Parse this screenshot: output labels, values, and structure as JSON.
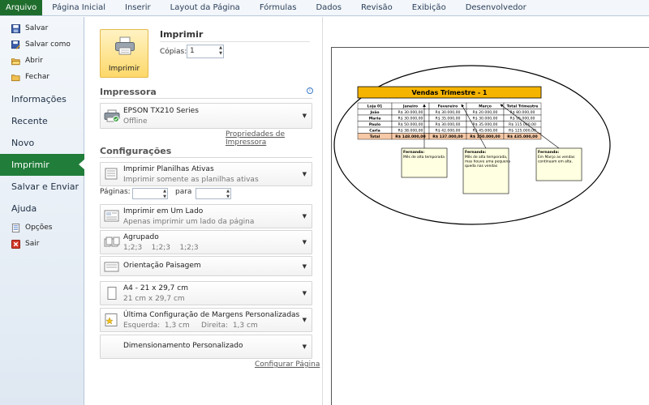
{
  "ribbon": {
    "tabs": [
      "Arquivo",
      "Página Inicial",
      "Inserir",
      "Layout da Página",
      "Fórmulas",
      "Dados",
      "Revisão",
      "Exibição",
      "Desenvolvedor"
    ]
  },
  "nav": {
    "save": "Salvar",
    "save_as": "Salvar como",
    "open": "Abrir",
    "close": "Fechar",
    "info": "Informações",
    "recent": "Recente",
    "new": "Novo",
    "print": "Imprimir",
    "save_send": "Salvar e Enviar",
    "help": "Ajuda",
    "options": "Opções",
    "exit": "Sair"
  },
  "print": {
    "button_label": "Imprimir",
    "title": "Imprimir",
    "copies_label": "Cópias:",
    "copies_value": "1"
  },
  "printer": {
    "section_title": "Impressora",
    "name": "EPSON TX210 Series",
    "status": "Offline",
    "properties_link": "Propriedades de Impressora"
  },
  "settings": {
    "section_title": "Configurações",
    "scope_main": "Imprimir Planilhas Ativas",
    "scope_sub": "Imprimir somente as planilhas ativas",
    "pages_label": "Páginas:",
    "to_label": "para",
    "sides_main": "Imprimir em Um Lado",
    "sides_sub": "Apenas imprimir um lado da página",
    "collate_main": "Agrupado",
    "collate_sub": "1;2;3    1;2;3    1;2;3",
    "orientation": "Orientação Paisagem",
    "paper_main": "A4 - 21 x 29,7 cm",
    "paper_sub": "21 cm x 29,7 cm",
    "margins_main": "Última Configuração de Margens Personalizadas",
    "margins_sub": "Esquerda:  1,3 cm     Direita:  1,3 cm",
    "scaling": "Dimensionamento Personalizado",
    "page_setup_link": "Configurar Página"
  },
  "sheet": {
    "title": "Vendas Trimestre - 1",
    "headers": [
      "Loja 01",
      "Janeiro",
      "Fevereiro",
      "Março",
      "Total Trimestre"
    ],
    "rows": [
      [
        "João",
        "R$ 30.000,00",
        "R$ 30.000,00",
        "R$ 20.000,00",
        "R$ 80.000,00"
      ],
      [
        "Maria",
        "R$ 30.000,00",
        "R$ 35.000,00",
        "R$ 30.000,00",
        "R$ 95.000,00"
      ],
      [
        "Paulo",
        "R$ 50.000,00",
        "R$ 30.000,00",
        "R$ 35.000,00",
        "R$ 115.000,00"
      ],
      [
        "Carla",
        "R$ 38.000,00",
        "R$ 42.000,00",
        "R$ 45.000,00",
        "R$ 125.000,00"
      ]
    ],
    "total_row": [
      "Total",
      "R$ 148.000,00",
      "R$ 137.000,00",
      "R$ 150.000,00",
      "R$ 435.000,00"
    ],
    "comments": [
      {
        "author": "Fernanda:",
        "text": "Mês de alta temporada"
      },
      {
        "author": "Fernanda:",
        "text": "Mês de alta temporada, mas houve uma pequena queda nas vendas"
      },
      {
        "author": "Fernanda:",
        "text": "Em Março as vendas continuam em alta."
      }
    ]
  },
  "colors": {
    "file_tab": "#1f6d2d",
    "selected_nav": "#217d3a",
    "print_button": "#fdd86a",
    "sheet_title_fill": "#f5b400",
    "total_row_fill": "#f7c9a6",
    "comment_fill": "#ffffe1"
  }
}
